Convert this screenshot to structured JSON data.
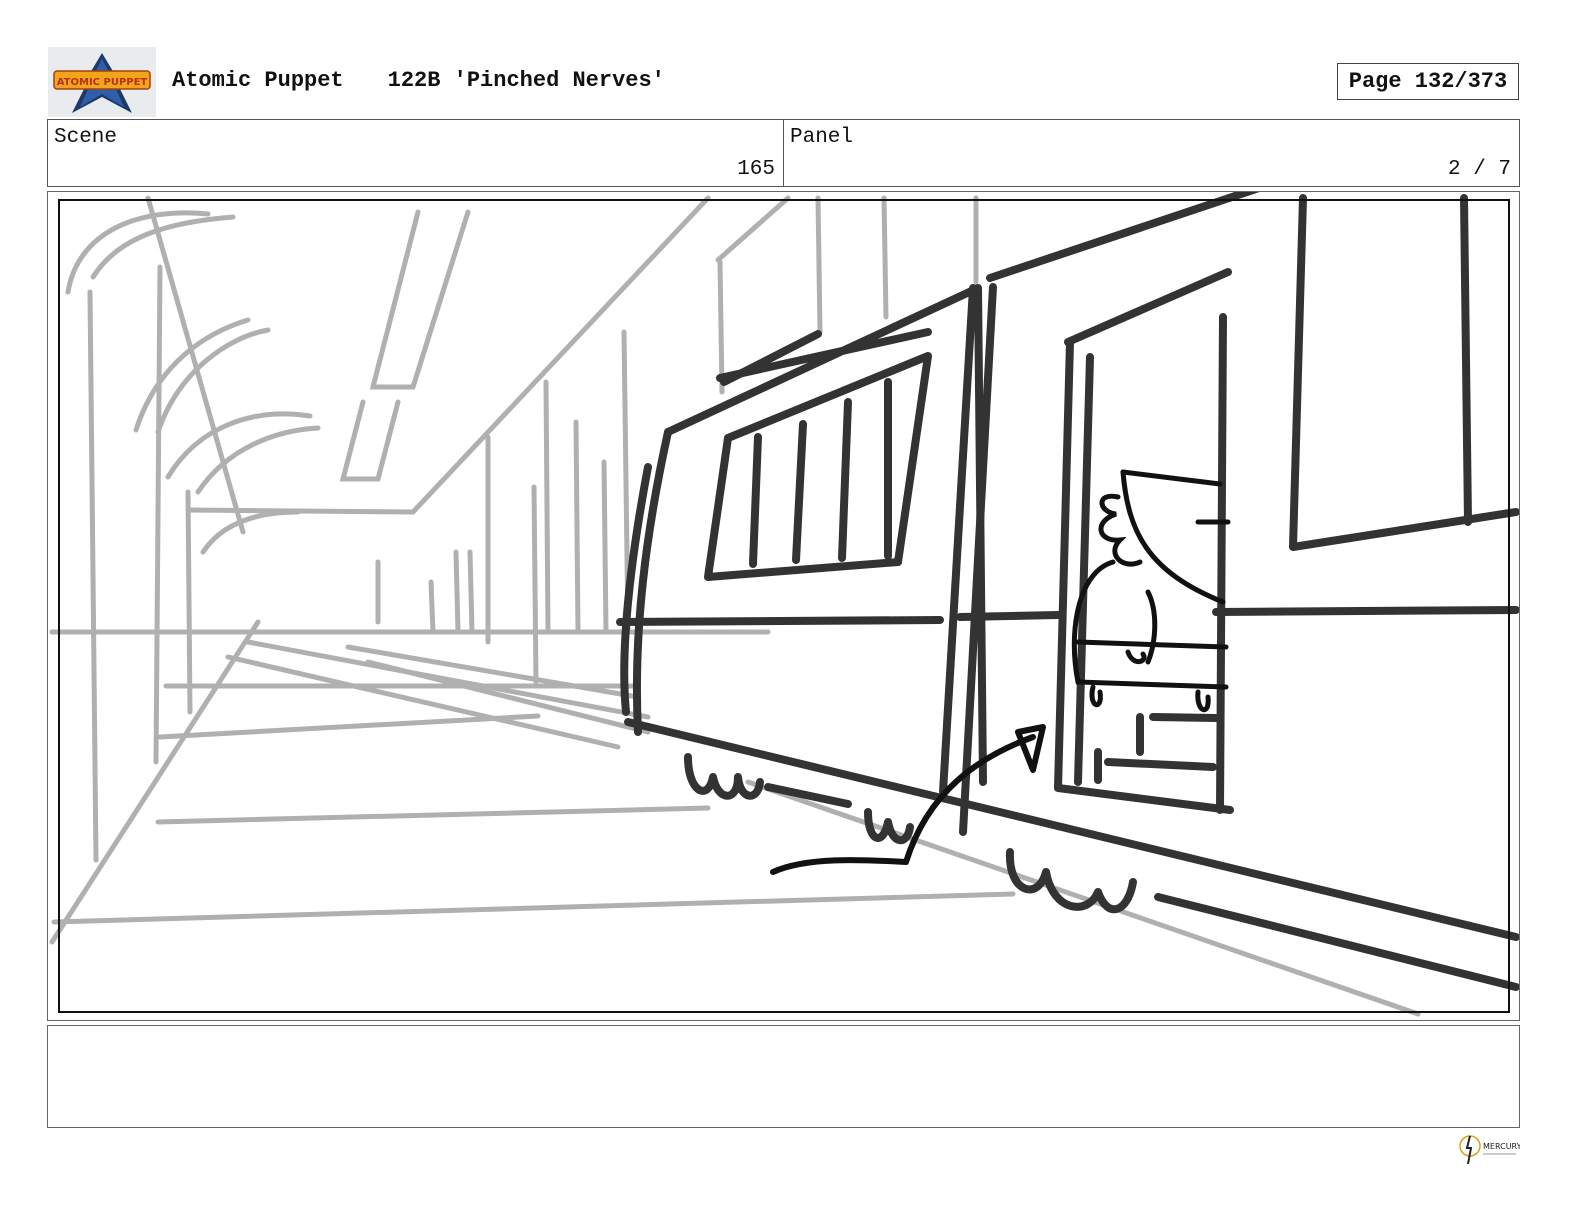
{
  "header": {
    "show_name": "Atomic Puppet",
    "episode": "122B 'Pinched Nerves'",
    "page_label": "Page 132/373"
  },
  "logo": {
    "text": "ATOMIC PUPPET",
    "icon": "atomic-puppet-logo"
  },
  "scene": {
    "label": "Scene",
    "value": "165"
  },
  "panel": {
    "label": "Panel",
    "value": "2 / 7"
  },
  "storyboard_frame": {
    "description_icon": "subway-train-sketch",
    "colors": {
      "rough_lines": "#b0b0b0",
      "ink_lines": "#333333",
      "arrow": "#111111"
    }
  },
  "notes": {
    "text": ""
  },
  "footer": {
    "brand_text": "MERCURY",
    "icon": "mercury-filmworks-logo"
  }
}
